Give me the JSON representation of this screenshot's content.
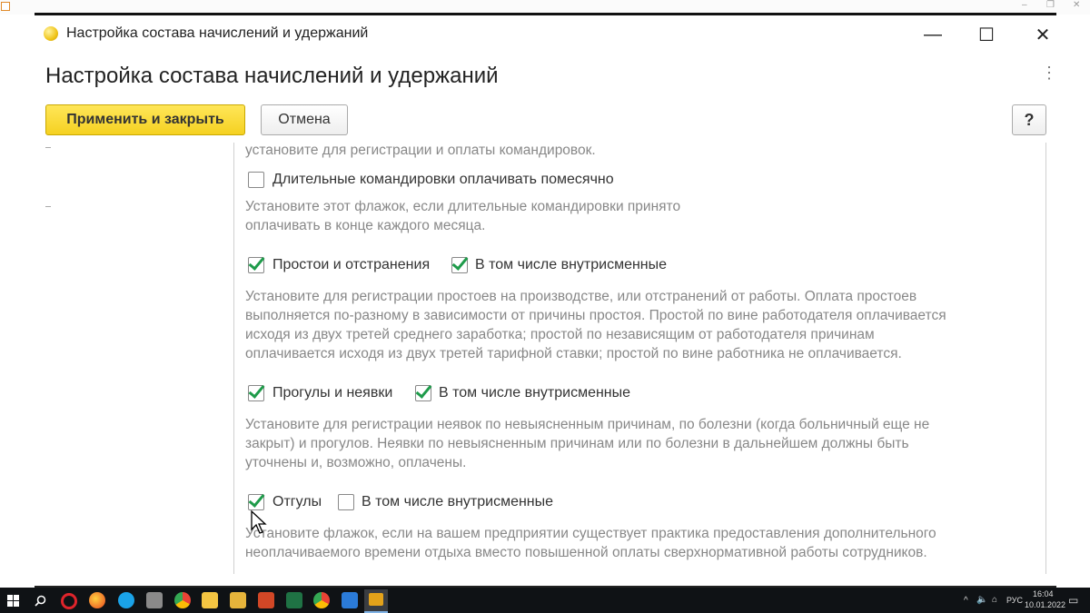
{
  "window": {
    "title": "Настройка состава начислений и удержаний",
    "minimize_glyph": "—",
    "maximize_glyph": "☐",
    "close_glyph": "✕"
  },
  "form": {
    "title": "Настройка состава начислений и удержаний",
    "more_glyph": "⋮"
  },
  "toolbar": {
    "apply_close_label": "Применить и закрыть",
    "cancel_label": "Отмена",
    "help_label": "?"
  },
  "content": {
    "cut_text": "установите для регистрации и оплаты командировок.",
    "long_trips": {
      "label": "Длительные командировки оплачивать помесячно",
      "checked": false,
      "desc_lines": [
        "Установите этот флажок, если длительные командировки принято",
        "оплачивать в конце каждого месяца."
      ]
    },
    "downtime": {
      "label": "Простои и отстранения",
      "checked": true,
      "sub_label": "В том числе внутрисменные",
      "sub_checked": true,
      "desc_lines": [
        "Установите для регистрации простоев на производстве, или отстранений от работы. Оплата простоев",
        "выполняется по-разному в зависимости от причины простоя. Простой по вине работодателя оплачивается",
        "исходя из двух третей среднего заработка; простой по независящим от работодателя причинам",
        "оплачивается исходя из двух третей тарифной ставки; простой по вине работника не оплачивается."
      ]
    },
    "absences": {
      "label": "Прогулы и неявки",
      "checked": true,
      "sub_label": "В том числе внутрисменные",
      "sub_checked": true,
      "desc_lines": [
        "Установите для регистрации неявок по невыясненным причинам, по болезни (когда больничный еще не",
        "закрыт) и прогулов. Неявки по невыясненным причинам или по болезни в дальнейшем должны быть",
        "уточнены и, возможно, оплачены."
      ]
    },
    "time_off": {
      "label": "Отгулы",
      "checked": true,
      "sub_label": "В том числе внутрисменные",
      "sub_checked": false,
      "desc_lines": [
        "Установите флажок, если на вашем предприятии существует практика предоставления дополнительного",
        "неоплачиваемого времени отдыха вместо повышенной оплаты сверхнормативной работы сотрудников."
      ]
    }
  },
  "taskbar": {
    "language": "РУС",
    "time": "16:04",
    "date": "10.01.2022"
  },
  "colors": {
    "accent_yellow": "#f5d121",
    "check_green": "#1e9b4a",
    "hint_gray": "#888888"
  }
}
